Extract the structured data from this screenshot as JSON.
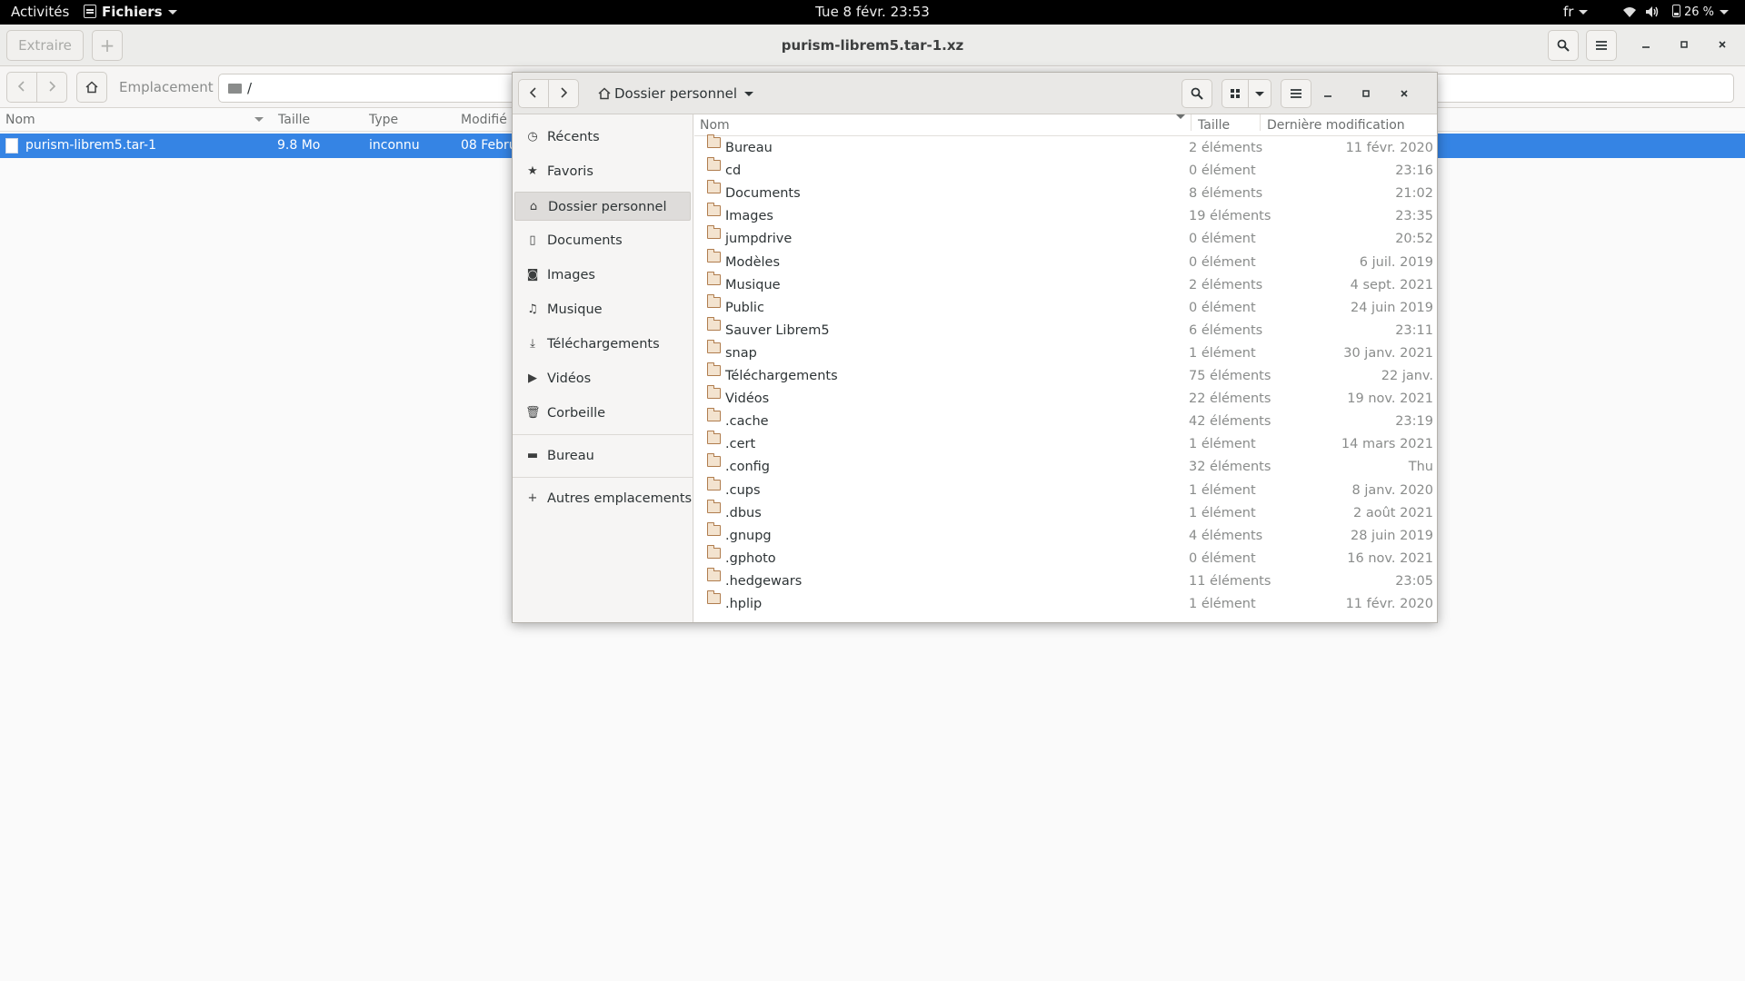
{
  "topbar": {
    "activities": "Activités",
    "app_menu": "Fichiers",
    "clock": "Tue 8 févr.  23:53",
    "lang": "fr",
    "battery": "26 %"
  },
  "archive": {
    "extract_label": "Extraire",
    "add_label": "+",
    "title": "purism-librem5.tar-1.xz",
    "location_label": "Emplacement :",
    "location_value": "/",
    "columns": {
      "name": "Nom",
      "size": "Taille",
      "type": "Type",
      "modified": "Modifié"
    },
    "row": {
      "name": "purism-librem5.tar-1",
      "size": "9.8 Mo",
      "type": "inconnu",
      "modified": "08 Febru"
    }
  },
  "dialog": {
    "location": "Dossier personnel",
    "sidebar": {
      "items": [
        {
          "label": "Récents",
          "icon": "clock-icon"
        },
        {
          "label": "Favoris",
          "icon": "star-icon"
        },
        {
          "label": "Dossier personnel",
          "icon": "home-icon"
        },
        {
          "label": "Documents",
          "icon": "document-icon"
        },
        {
          "label": "Images",
          "icon": "camera-icon"
        },
        {
          "label": "Musique",
          "icon": "music-icon"
        },
        {
          "label": "Téléchargements",
          "icon": "download-icon"
        },
        {
          "label": "Vidéos",
          "icon": "video-icon"
        },
        {
          "label": "Corbeille",
          "icon": "trash-icon"
        },
        {
          "label": "Bureau",
          "icon": "folder-icon"
        },
        {
          "label": "Autres emplacements",
          "icon": "plus-icon"
        }
      ]
    },
    "columns": {
      "name": "Nom",
      "size": "Taille",
      "modified": "Dernière modification"
    },
    "files": [
      {
        "name": "Bureau",
        "size": "2 éléments",
        "modified": "11 févr. 2020"
      },
      {
        "name": "cd",
        "size": "0 élément",
        "modified": "23:16"
      },
      {
        "name": "Documents",
        "size": "8 éléments",
        "modified": "21:02"
      },
      {
        "name": "Images",
        "size": "19 éléments",
        "modified": "23:35"
      },
      {
        "name": "jumpdrive",
        "size": "0 élément",
        "modified": "20:52"
      },
      {
        "name": "Modèles",
        "size": "0 élément",
        "modified": "6 juil. 2019"
      },
      {
        "name": "Musique",
        "size": "2 éléments",
        "modified": "4 sept. 2021"
      },
      {
        "name": "Public",
        "size": "0 élément",
        "modified": "24 juin 2019"
      },
      {
        "name": "Sauver Librem5",
        "size": "6 éléments",
        "modified": "23:11"
      },
      {
        "name": "snap",
        "size": "1 élément",
        "modified": "30 janv. 2021"
      },
      {
        "name": "Téléchargements",
        "size": "75 éléments",
        "modified": "22 janv."
      },
      {
        "name": "Vidéos",
        "size": "22 éléments",
        "modified": "19 nov. 2021"
      },
      {
        "name": ".cache",
        "size": "42 éléments",
        "modified": "23:19"
      },
      {
        "name": ".cert",
        "size": "1 élément",
        "modified": "14 mars 2021"
      },
      {
        "name": ".config",
        "size": "32 éléments",
        "modified": "Thu"
      },
      {
        "name": ".cups",
        "size": "1 élément",
        "modified": "8 janv. 2020"
      },
      {
        "name": ".dbus",
        "size": "1 élément",
        "modified": "2 août 2021"
      },
      {
        "name": ".gnupg",
        "size": "4 éléments",
        "modified": "28 juin 2019"
      },
      {
        "name": ".gphoto",
        "size": "0 élément",
        "modified": "16 nov. 2021"
      },
      {
        "name": ".hedgewars",
        "size": "11 éléments",
        "modified": "23:05"
      },
      {
        "name": ".hplip",
        "size": "1 élément",
        "modified": "11 févr. 2020"
      }
    ]
  }
}
